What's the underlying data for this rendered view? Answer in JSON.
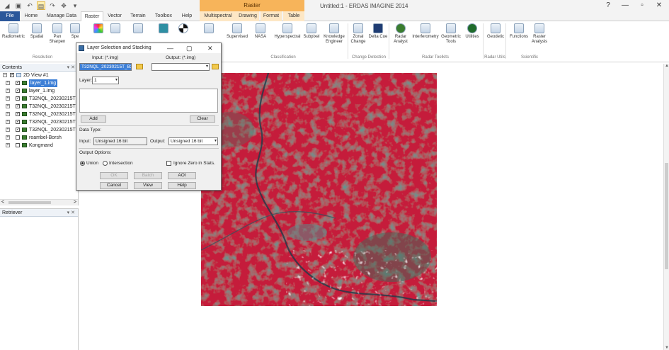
{
  "titlebar": {
    "app_title": "Untitled:1 - ERDAS IMAGINE 2014",
    "context_group": "Raster",
    "quick_access": [
      "app-menu",
      "save",
      "open",
      "undo",
      "redo",
      "customize"
    ],
    "window_controls": [
      "?",
      "—",
      "▫",
      "✕"
    ]
  },
  "tabs": [
    "File",
    "Home",
    "Manage Data",
    "Raster",
    "Vector",
    "Terrain",
    "Toolbox",
    "Help",
    "Multispectral",
    "Drawing",
    "Format",
    "Table"
  ],
  "ribbon": {
    "buttons": [
      "Radiometric",
      "Spatial",
      "Pan Sharpen",
      "Spe",
      "Supervised",
      "NASA",
      "Hyperspectral",
      "Subpixel",
      "Knowledge Engineer",
      "Zonal Change",
      "Delta Cue",
      "Radar Analyst",
      "Interferometry",
      "Geometric Tools",
      "Utilities",
      "Geodetic",
      "Functions",
      "Raster Analysis"
    ],
    "groups": [
      "Resolution",
      "Classification",
      "Change Detection",
      "Radar Toolkits",
      "Radar Utils",
      "Scientific"
    ]
  },
  "contents": {
    "title": "Contents",
    "tree": [
      {
        "label": "2D View #1",
        "level": 0,
        "checked": true
      },
      {
        "label": "layer_1.img",
        "level": 1,
        "checked": true,
        "selected": true
      },
      {
        "label": "layer_1.img",
        "level": 1,
        "checked": true
      },
      {
        "label": "T32NQL_20230215T",
        "level": 1,
        "checked": true
      },
      {
        "label": "T32NQL_20230215T",
        "level": 1,
        "checked": true
      },
      {
        "label": "T32NQL_20230215T",
        "level": 1,
        "checked": true
      },
      {
        "label": "T32NQL_20230215T",
        "level": 1,
        "checked": true
      },
      {
        "label": "T32NQL_20230215T",
        "level": 1,
        "checked": true
      },
      {
        "label": "roambel-Borsh",
        "level": 1,
        "checked": false
      },
      {
        "label": "Kongmand",
        "level": 1,
        "checked": false
      }
    ]
  },
  "retriever": {
    "title": "Retriever"
  },
  "dialog": {
    "title": "Layer Selection and Stacking",
    "input_label": "Input: (*.img)",
    "output_label": "Output: (*.img)",
    "input_value": "T32NQL_20230215T_B2",
    "output_value": "",
    "layer_label": "Layer:",
    "layer_value": "1",
    "add_button": "Add",
    "clear_button": "Clear",
    "data_type_label": "Data Type:",
    "input_type_label": "Input:",
    "input_type_value": "Unsigned 16 bit",
    "output_type_label": "Output:",
    "output_type_value": "Unsigned 16 bit",
    "output_options_label": "Output Options:",
    "union_label": "Union",
    "intersection_label": "Intersection",
    "ignore_zero_label": "Ignore Zero in Stats.",
    "ok_button": "OK",
    "batch_button": "Batch",
    "aoi_button": "AOI",
    "cancel_button": "Cancel",
    "view_button": "View",
    "help_button": "Help"
  },
  "colors": {
    "ribbon_file_tab": "#2b579a",
    "context_group": "#f7b45a",
    "selection": "#3d7fd6",
    "vegetation_red": "#c81e3c",
    "water_dark": "#1e3c4a",
    "clouds": "#f0f4f6"
  }
}
